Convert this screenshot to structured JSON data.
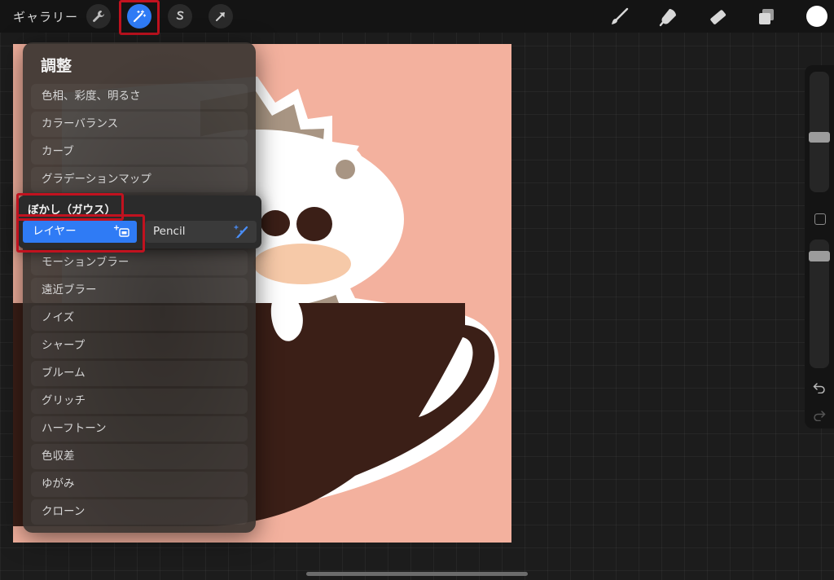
{
  "toolbar": {
    "gallery_label": "ギャラリー",
    "left_icons": [
      "wrench-icon",
      "magic-wand-icon",
      "selection-s-icon",
      "transform-arrow-icon"
    ],
    "right_icons": [
      "brush-icon",
      "smudge-icon",
      "eraser-icon",
      "layers-icon",
      "color-dot-icon"
    ],
    "color_swatch": "#ffffff"
  },
  "adjustments_menu": {
    "title": "調整",
    "items_top": [
      "色相、彩度、明るさ",
      "カラーバランス",
      "カーブ",
      "グラデーションマップ"
    ],
    "items_bottom": [
      "モーションブラー",
      "遠近ブラー",
      "ノイズ",
      "シャープ",
      "ブルーム",
      "グリッチ",
      "ハーフトーン",
      "色収差",
      "ゆがみ",
      "クローン"
    ]
  },
  "gaussian_blur": {
    "title": "ぼかし（ガウス）",
    "option_layer": "レイヤー",
    "option_pencil": "Pencil",
    "layer_icon": "layer-sparkle-icon",
    "pencil_icon": "pencil-sparkle-icon"
  },
  "sidebar": {
    "icons": [
      "modify-square-icon",
      "undo-icon",
      "redo-icon"
    ]
  },
  "colors": {
    "accent_blue": "#2f7bf5",
    "highlight_red": "#c1121f",
    "canvas_background": "#f3b19e"
  }
}
